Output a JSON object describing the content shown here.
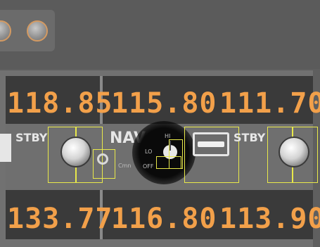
{
  "top_panel": {
    "buttons": [
      "round-button-1",
      "round-button-2"
    ]
  },
  "com": {
    "active": "118.85"
  },
  "nav": {
    "active": "115.80",
    "standby": "111.70",
    "label": "NAV",
    "switch_positions": [
      "HI",
      "LO",
      "OFF"
    ],
    "on_label": "Cmn"
  },
  "stby_label": "STBY",
  "row2": {
    "com": "133.77",
    "nav_active": "116.80",
    "nav_standby": "113.90"
  },
  "colors": {
    "lcd": "#f2a04a",
    "highlight": "#e8e84a",
    "panel": "#717171",
    "display_bg": "#3a3a3a"
  }
}
